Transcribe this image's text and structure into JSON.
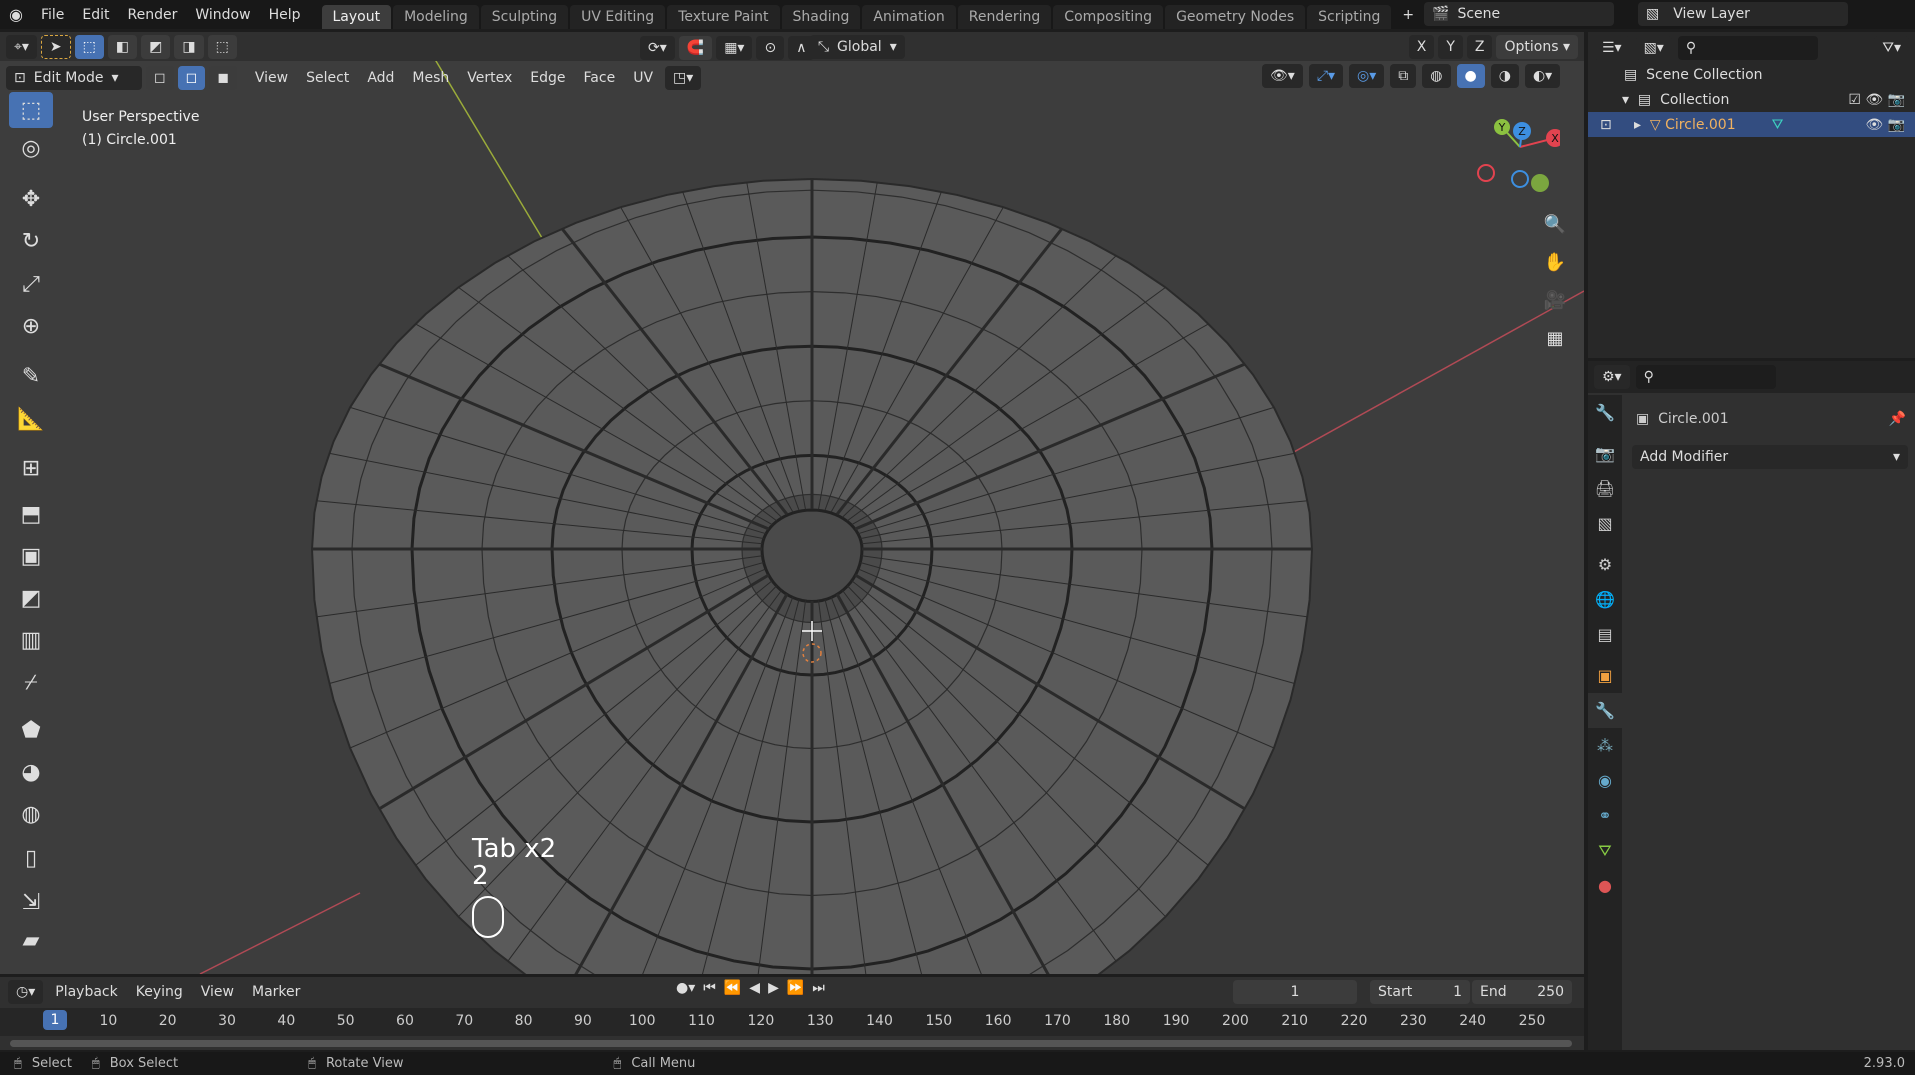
{
  "menu": [
    "File",
    "Edit",
    "Render",
    "Window",
    "Help"
  ],
  "workspaces": [
    "Layout",
    "Modeling",
    "Sculpting",
    "UV Editing",
    "Texture Paint",
    "Shading",
    "Animation",
    "Rendering",
    "Compositing",
    "Geometry Nodes",
    "Scripting"
  ],
  "scene": "Scene",
  "view_layer": "View Layer",
  "header": {
    "orientation": "Global",
    "options": "Options",
    "axes": [
      "X",
      "Y",
      "Z"
    ]
  },
  "mode": {
    "label": "Edit Mode",
    "menus": [
      "View",
      "Select",
      "Add",
      "Mesh",
      "Vertex",
      "Edge",
      "Face",
      "UV"
    ]
  },
  "viewport": {
    "perspective": "User Perspective",
    "object": "(1) Circle.001",
    "key_overlay": "Tab x2",
    "key_overlay2": "2"
  },
  "gizmo": {
    "x": "X",
    "y": "Y",
    "z": "Z"
  },
  "outliner": {
    "scene_collection": "Scene Collection",
    "collection": "Collection",
    "object": "Circle.001"
  },
  "properties": {
    "object": "Circle.001",
    "add_modifier": "Add Modifier"
  },
  "timeline": {
    "menus": [
      "Playback",
      "Keying",
      "View",
      "Marker"
    ],
    "current_frame": "1",
    "start_label": "Start",
    "start": "1",
    "end_label": "End",
    "end": "250",
    "ticks": [
      "1",
      "10",
      "20",
      "30",
      "40",
      "50",
      "60",
      "70",
      "80",
      "90",
      "100",
      "110",
      "120",
      "130",
      "140",
      "150",
      "160",
      "170",
      "180",
      "190",
      "200",
      "210",
      "220",
      "230",
      "240",
      "250"
    ]
  },
  "status": {
    "select": "Select",
    "box_select": "Box Select",
    "rotate": "Rotate View",
    "call_menu": "Call Menu",
    "version": "2.93.0"
  },
  "colors": {
    "accent": "#4772b3",
    "selected_object": "#f0b160",
    "x_axis": "#e2434f",
    "y_axis": "#8bc140",
    "z_axis": "#3d8fe0"
  }
}
